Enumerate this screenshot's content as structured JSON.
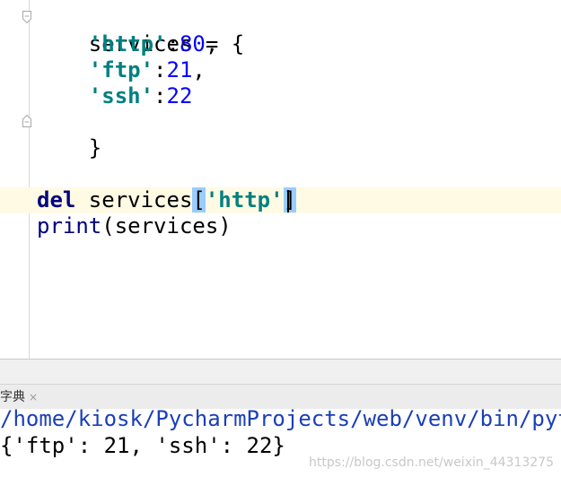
{
  "editor": {
    "lines": {
      "l1": {
        "a": "services = {"
      },
      "l2": {
        "key": "'http'",
        "colon": ":",
        "val": "80",
        "comma": ","
      },
      "l3": {
        "key": "'ftp'",
        "colon": ":",
        "val": "21",
        "comma": ","
      },
      "l4": {
        "key": "'ssh'",
        "colon": ":",
        "val": "22"
      },
      "l5": {
        "a": "}"
      },
      "l6": {
        "kw": "del",
        "name": " services",
        "lb": "[",
        "key": "'http'",
        "rb": "]"
      },
      "l7": {
        "fn": "print",
        "args": "(services)"
      }
    }
  },
  "run": {
    "tab_label": "字典",
    "tab_close": "×"
  },
  "console": {
    "path": "/home/kiosk/PycharmProjects/web/venv/bin/pyth",
    "output": "{'ftp': 21, 'ssh': 22}"
  },
  "watermark": "https://blog.csdn.net/weixin_44313275",
  "colors": {
    "keyword": "#000080",
    "string": "#008080",
    "number": "#0000ff",
    "caret_line": "#fffae3",
    "brace_match": "#99ccff"
  }
}
